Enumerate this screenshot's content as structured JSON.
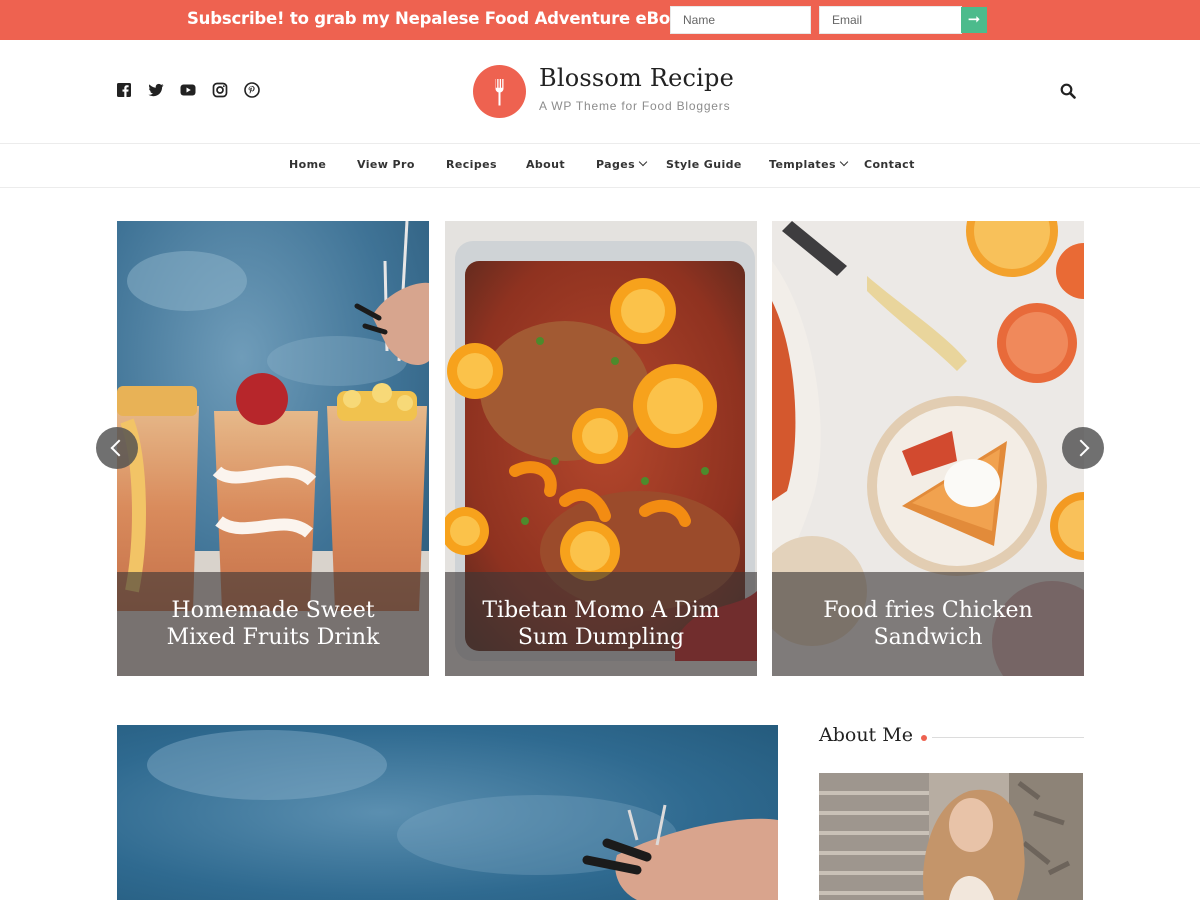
{
  "subscribe_bar": {
    "text": "Subscribe! to grab my Nepalese Food Adventure eBook!",
    "name_placeholder": "Name",
    "email_placeholder": "Email",
    "submit_icon": "arrow-right-icon"
  },
  "header": {
    "social_icons": [
      "facebook-icon",
      "twitter-icon",
      "youtube-icon",
      "instagram-icon",
      "pinterest-icon"
    ],
    "logo_icon": "fork-icon",
    "site_title": "Blossom Recipe",
    "tagline": "A WP Theme for Food Bloggers",
    "search_icon": "search-icon"
  },
  "nav": {
    "items": [
      {
        "label": "Home"
      },
      {
        "label": "View Pro"
      },
      {
        "label": "Recipes"
      },
      {
        "label": "About"
      },
      {
        "label": "Pages"
      },
      {
        "label": "Style Guide"
      },
      {
        "label": "Templates"
      },
      {
        "label": "Contact"
      }
    ]
  },
  "slider": {
    "prev_icon": "chevron-left-icon",
    "next_icon": "chevron-right-icon",
    "slides": [
      {
        "title": "Homemade Sweet Mixed Fruits Drink"
      },
      {
        "title": "Tibetan Momo A Dim Sum Dumpling"
      },
      {
        "title": "Food fries Chicken Sandwich"
      }
    ]
  },
  "sidebar": {
    "about_title": "About Me"
  },
  "colors": {
    "accent": "#ee6250",
    "submit_button": "#4cbb8c"
  }
}
